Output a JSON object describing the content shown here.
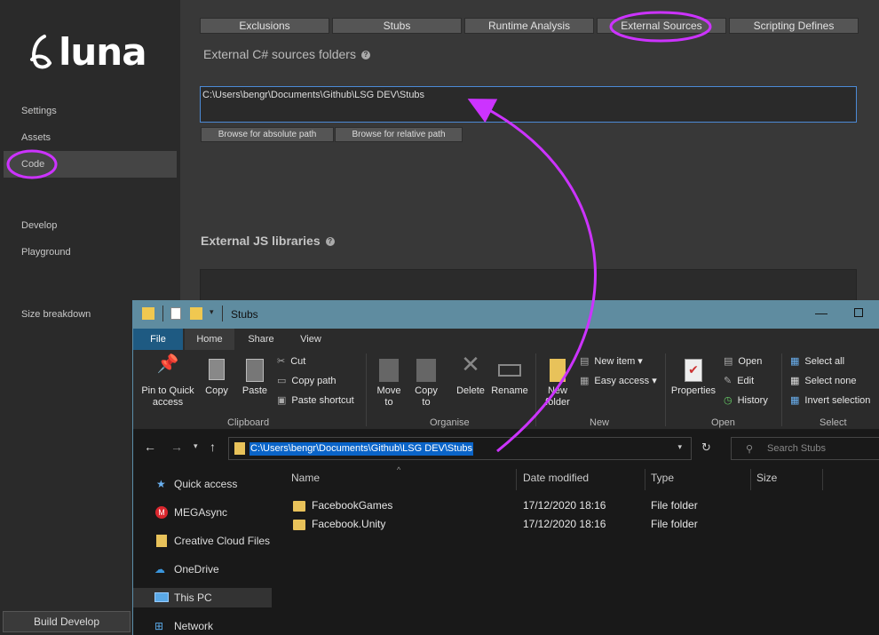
{
  "luna": {
    "logo_text": "luna",
    "nav": {
      "settings": "Settings",
      "assets": "Assets",
      "code": "Code",
      "develop": "Develop",
      "playground": "Playground",
      "size_breakdown": "Size breakdown"
    },
    "build_button": "Build Develop",
    "tabs": [
      "Exclusions",
      "Stubs",
      "Runtime Analysis",
      "External Sources",
      "Scripting Defines"
    ],
    "csharp_title": "External C# sources folders",
    "csharp_path": "C:\\Users\\bengr\\Documents\\Github\\LSG DEV\\Stubs",
    "browse_absolute": "Browse for absolute path",
    "browse_relative": "Browse for relative path",
    "js_title": "External JS libraries",
    "help_glyph": "?"
  },
  "explorer": {
    "title": "Stubs",
    "ribbon_tabs": [
      "File",
      "Home",
      "Share",
      "View"
    ],
    "clipboard": {
      "pin": "Pin to Quick access",
      "copy": "Copy",
      "paste": "Paste",
      "cut": "Cut",
      "copy_path": "Copy path",
      "paste_shortcut": "Paste shortcut",
      "label": "Clipboard"
    },
    "organise": {
      "move_to": "Move to",
      "copy_to": "Copy to",
      "delete": "Delete",
      "rename": "Rename",
      "label": "Organise"
    },
    "new": {
      "new_folder": "New folder",
      "new_item": "New item",
      "easy_access": "Easy access",
      "label": "New"
    },
    "open": {
      "properties": "Properties",
      "open": "Open",
      "edit": "Edit",
      "history": "History",
      "label": "Open"
    },
    "select": {
      "select_all": "Select all",
      "select_none": "Select none",
      "invert": "Invert selection",
      "label": "Select"
    },
    "address": "C:\\Users\\bengr\\Documents\\Github\\LSG DEV\\Stubs",
    "search_placeholder": "Search Stubs",
    "nav_pane": [
      "Quick access",
      "MEGAsync",
      "Creative Cloud Files",
      "OneDrive",
      "This PC",
      "Network"
    ],
    "columns": [
      "Name",
      "Date modified",
      "Type",
      "Size"
    ],
    "files": [
      {
        "name": "FacebookGames",
        "date": "17/12/2020 18:16",
        "type": "File folder"
      },
      {
        "name": "Facebook.Unity",
        "date": "17/12/2020 18:16",
        "type": "File folder"
      }
    ]
  },
  "colors": {
    "highlight": "#cc33ff",
    "selection": "#0a64c8"
  }
}
